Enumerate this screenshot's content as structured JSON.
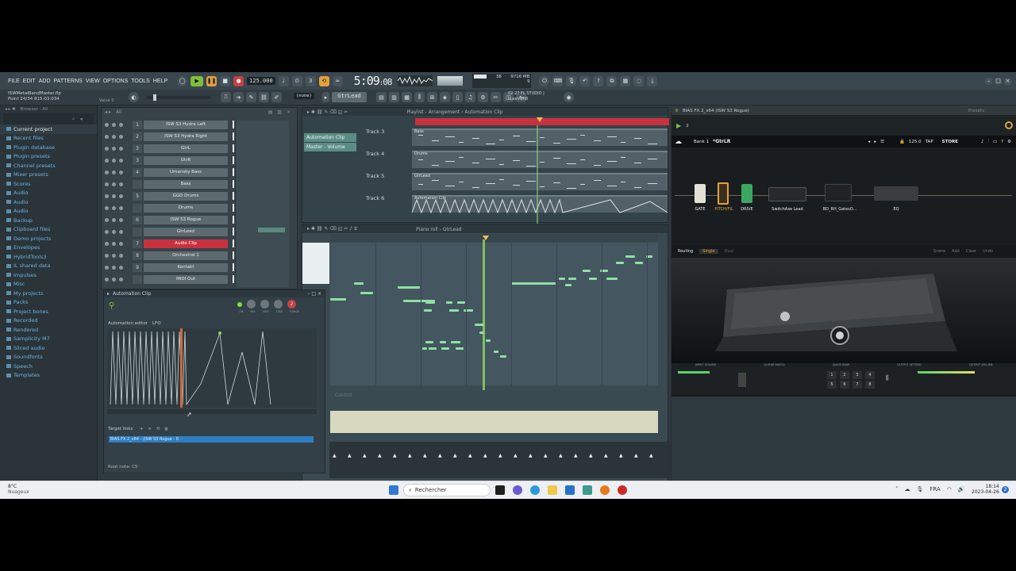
{
  "menubar": {
    "items": [
      "FILE",
      "EDIT",
      "ADD",
      "PATTERNS",
      "VIEW",
      "OPTIONS",
      "TOOLS",
      "HELP"
    ],
    "tempo": "125.000",
    "time": "5:09",
    "time_small": "08",
    "cpu_label": "38",
    "mem_label": "9716 MB",
    "mem_sub": "9",
    "fl_news_line1": "02-27  FL STUDIO |",
    "fl_news_line2": "LuxeVERB"
  },
  "project": {
    "file": "ISWMetalBandMaster.flp",
    "hint": "Point 24/34 815:03:034",
    "value_label": "Value 0",
    "pattern_none": "(none)",
    "pattern_name": "GtrLead"
  },
  "browser": {
    "header": "Browser - All",
    "items": [
      "Current project",
      "Recent files",
      "Plugin database",
      "Plugin presets",
      "Channel presets",
      "Mixer presets",
      "Scores",
      "Audio",
      "Audio",
      "Audio",
      "Backup",
      "Clipboard files",
      "Demo projects",
      "Envelopes",
      "HybridTools3",
      "IL shared data",
      "Impulses",
      "Misc",
      "My projects",
      "Packs",
      "Project bones",
      "Recorded",
      "Rendered",
      "Samplicity M7",
      "Sliced audio",
      "Soundfonts",
      "Speech",
      "Templates"
    ]
  },
  "rack": {
    "filter": "All",
    "channels": [
      {
        "num": "1",
        "name": "ISW S3 Hydra Left"
      },
      {
        "num": "2",
        "name": "ISW S3 Hydra Right"
      },
      {
        "num": "3",
        "name": "GtrL"
      },
      {
        "num": "3",
        "name": "GtrR"
      },
      {
        "num": "4",
        "name": "Umansky Bass"
      },
      {
        "num": "",
        "name": "Bass"
      },
      {
        "num": "5",
        "name": "GGD Drums"
      },
      {
        "num": "",
        "name": "Drums"
      },
      {
        "num": "6",
        "name": "ISW S3 Rogue"
      },
      {
        "num": "",
        "name": "GtrLead"
      },
      {
        "num": "7",
        "name": "Audio Clip"
      },
      {
        "num": "8",
        "name": "Orchestral 1"
      },
      {
        "num": "9",
        "name": "Kontakt"
      },
      {
        "num": "",
        "name": "MIDI Out"
      }
    ]
  },
  "playlist": {
    "title": "Playlist - Arrangement › Automation Clip",
    "clips": [
      "Automation Clip",
      "Master - Volume"
    ],
    "tracks": [
      {
        "name": "Track 3",
        "clip": "Bass"
      },
      {
        "name": "Track 4",
        "clip": "Drums"
      },
      {
        "name": "Track 5",
        "clip": "GtrLead"
      },
      {
        "name": "Track 6",
        "clip": "Automation Clip"
      }
    ],
    "ruler": [
      "2",
      "3",
      "4",
      "5",
      "6",
      "7",
      "8",
      "9"
    ]
  },
  "piano": {
    "title": "Piano roll - GtrLead",
    "ruler": [
      "1",
      "2",
      "3",
      "4",
      "5",
      "6",
      "7",
      "8"
    ],
    "velocity_label": "Control"
  },
  "automation": {
    "title": "Automation Clip",
    "editor_label": "Automation editor",
    "lfo_label": "LFO",
    "knob_labels": [
      "ON",
      "MIX",
      "MAX",
      "TIME",
      "RANGE"
    ],
    "knob_value": "2",
    "target_label": "Target links",
    "target_item": "BIAS FX 2_x64 - (ISW S3 Rogue - 0",
    "root_note": "Root note: C5"
  },
  "bias": {
    "title": "BIAS FX 2_x64 (ISW S3 Rogue)",
    "presets_label": "Presets",
    "bank": "Bank 1",
    "preset": "*GtrLR",
    "bpm": "125.0",
    "tap": "TAP",
    "store": "STORE",
    "chain": [
      "GATE",
      "PITCH/FIL",
      "DRIVE",
      "SwitchAxe Lead",
      "BD_RH_GatesO...",
      "EQ"
    ],
    "routing": "Routing",
    "single": "Single",
    "dual": "Dual",
    "actions": [
      "Scene",
      "Add",
      "Clear",
      "Undo"
    ],
    "bottom_labels": [
      "INPUT VOLUME",
      "GUITAR MATCH",
      "QUICK SNAP",
      "OUTPUT SETTING",
      "OUTPUT VOLUME"
    ],
    "quick_snap": [
      "1",
      "2",
      "3",
      "4",
      "5",
      "6",
      "7",
      "8"
    ],
    "accent": "#e3a13d"
  },
  "taskbar": {
    "weather_temp": "8°C",
    "weather_text": "Nuageux",
    "search": "Rechercher",
    "lang": "FRA",
    "time": "18:14",
    "date": "2023-04-26",
    "badge": "2"
  }
}
